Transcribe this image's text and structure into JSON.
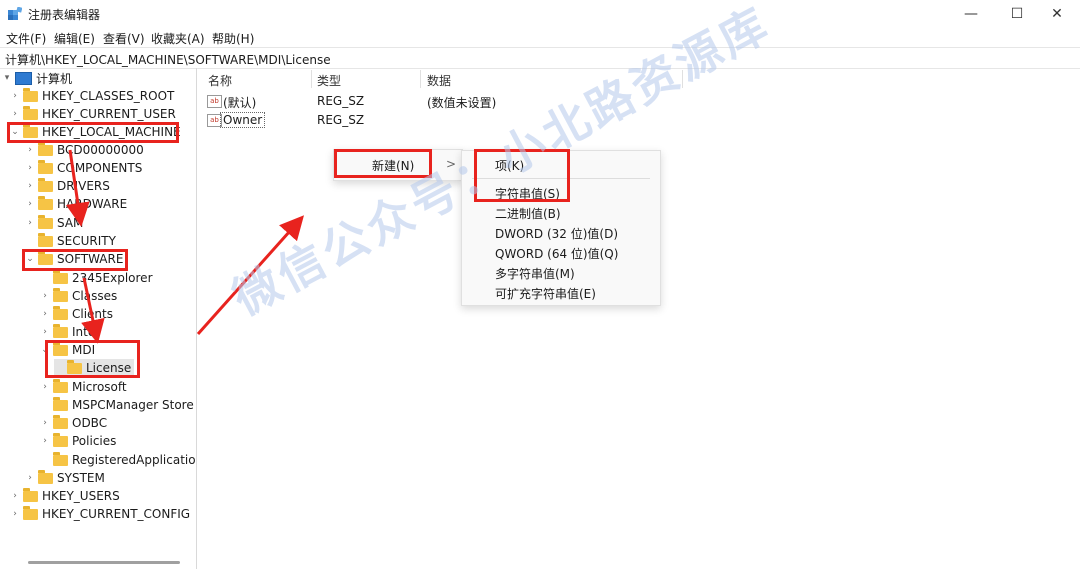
{
  "window": {
    "title": "注册表编辑器",
    "minimize": "—",
    "maximize": "☐",
    "close": "✕"
  },
  "menu": [
    "文件(F)",
    "编辑(E)",
    "查看(V)",
    "收藏夹(A)",
    "帮助(H)"
  ],
  "address": "计算机\\HKEY_LOCAL_MACHINE\\SOFTWARE\\MDI\\License",
  "tree": {
    "root": "计算机",
    "hives": {
      "classes_root": "HKEY_CLASSES_ROOT",
      "current_user": "HKEY_CURRENT_USER",
      "local_machine": "HKEY_LOCAL_MACHINE",
      "users": "HKEY_USERS",
      "current_config": "HKEY_CURRENT_CONFIG"
    },
    "hklm_children": {
      "bcd": "BCD00000000",
      "components": "COMPONENTS",
      "drivers": "DRIVERS",
      "hardware": "HARDWARE",
      "sam": "SAM",
      "security": "SECURITY",
      "software": "SOFTWARE",
      "system": "SYSTEM"
    },
    "software_children": {
      "explorer2345": "2345Explorer",
      "classes": "Classes",
      "clients": "Clients",
      "intel": "Intel",
      "mdi": "MDI",
      "license": "License",
      "microsoft": "Microsoft",
      "mspc": "MSPCManager Store",
      "odbc": "ODBC",
      "policies": "Policies",
      "regapps": "RegisteredApplications"
    }
  },
  "columns": {
    "name": "名称",
    "type": "类型",
    "data": "数据"
  },
  "values": [
    {
      "name": "(默认)",
      "type": "REG_SZ",
      "data": "(数值未设置)"
    },
    {
      "name": "Owner",
      "type": "REG_SZ",
      "data": ""
    }
  ],
  "context_menu": {
    "new": "新建(N)",
    "submenu_arrow": ">"
  },
  "submenu": {
    "key": "项(K)",
    "string": "字符串值(S)",
    "binary": "二进制值(B)",
    "dword": "DWORD (32 位)值(D)",
    "qword": "QWORD (64 位)值(Q)",
    "multi": "多字符串值(M)",
    "expand": "可扩充字符串值(E)"
  },
  "watermark": "微信公众号：小北路资源库",
  "colors": {
    "annotation_red": "#e8231e",
    "folder": "#f6c445",
    "selected_bg": "#e5e5e5"
  },
  "icons": {
    "value_type": "ab"
  }
}
